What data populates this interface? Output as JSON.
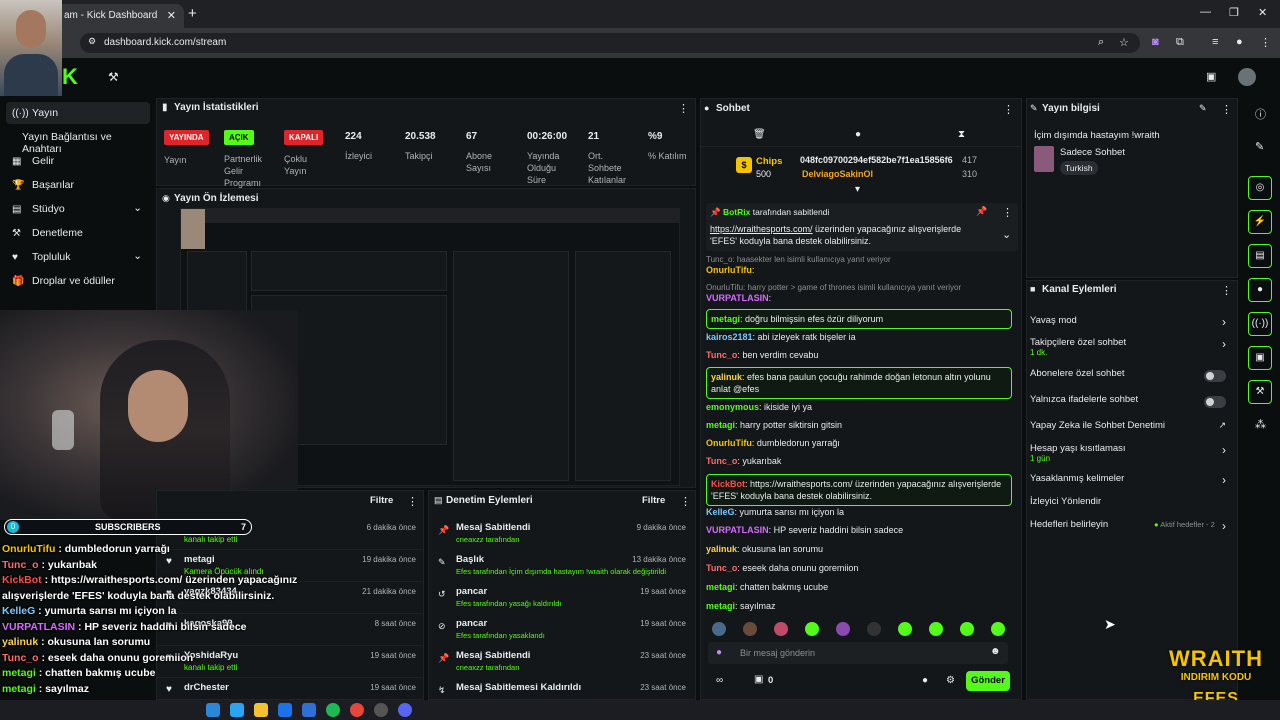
{
  "browser": {
    "tab_title": "am - Kick Dashboard",
    "url": "dashboard.kick.com/stream"
  },
  "sidebar": {
    "items": [
      {
        "label": "Yayın",
        "icon": "broadcast-icon"
      },
      {
        "label": "Yayın Bağlantısı ve Anahtarı",
        "icon": "key-icon"
      },
      {
        "label": "Gelir",
        "icon": "dollar-icon"
      },
      {
        "label": "Başarılar",
        "icon": "trophy-icon"
      },
      {
        "label": "Stüdyo",
        "icon": "studio-icon"
      },
      {
        "label": "Denetleme",
        "icon": "hammer-icon"
      },
      {
        "label": "Topluluk",
        "icon": "community-icon"
      },
      {
        "label": "Droplar ve ödüller",
        "icon": "gift-icon"
      }
    ]
  },
  "stats": {
    "title": "Yayın İstatistikleri",
    "badges": [
      {
        "badge": "YAYINDA",
        "label": "Yayın",
        "color": "#e0252a"
      },
      {
        "badge": "AÇIK",
        "label": "Partnerlik Gelir Programı",
        "color": "#53fc18"
      },
      {
        "badge": "KAPALI",
        "label": "Çoklu Yayın",
        "color": "#e0252a"
      }
    ],
    "numbers": [
      {
        "value": "224",
        "label": "İzleyici"
      },
      {
        "value": "20.538",
        "label": "Takipçi"
      },
      {
        "value": "67",
        "label": "Abone Sayısı"
      },
      {
        "value": "00:26:00",
        "label": "Yayında Olduğu Süre"
      },
      {
        "value": "21",
        "label": "Ort. Sohbete Katılanlar"
      },
      {
        "value": "%9",
        "label": "% Katılım"
      }
    ]
  },
  "preview": {
    "title": "Yayın Ön İzlemesi"
  },
  "events": {
    "filter_label": "Filtre",
    "rows": [
      {
        "name": "karthon",
        "sub": "kanalı takip etti",
        "time": "6 dakika önce"
      },
      {
        "name": "metagi",
        "sub": "Kamera Öpücük alındı",
        "time": "19 dakika önce"
      },
      {
        "name": "yagzk83434",
        "sub": "",
        "time": "21 dakika önce"
      },
      {
        "name": "kagoska99",
        "sub": "",
        "time": "8 saat önce"
      },
      {
        "name": "YoshidaRyu",
        "sub": "kanalı takip etti",
        "time": "19 saat önce"
      },
      {
        "name": "drChester",
        "sub": "",
        "time": "19 saat önce"
      }
    ]
  },
  "mod_actions": {
    "title": "Denetim Eylemleri",
    "filter_label": "Filtre",
    "rows": [
      {
        "title": "Mesaj Sabitlendi",
        "sub": "cneaxzz tarafından",
        "time": "9 dakika önce"
      },
      {
        "title": "Başlık",
        "sub": "Efes tarafından İçim dışımda hastayım !wraith olarak değiştirildi",
        "time": "13 dakika önce"
      },
      {
        "title": "pancar",
        "sub": "Efes tarafından yasağı kaldırıldı",
        "time": "19 saat önce"
      },
      {
        "title": "pancar",
        "sub": "Efes tarafından yasaklandı",
        "time": "19 saat önce"
      },
      {
        "title": "Mesaj Sabitlendi",
        "sub": "cneaxzz tarafından",
        "time": "23 saat önce"
      },
      {
        "title": "Mesaj Sabitlemesi Kaldırıldı",
        "sub": "",
        "time": "23 saat önce"
      }
    ]
  },
  "overlay": {
    "subscribers_label": "SUBSCRIBERS",
    "sub_count_left": "0",
    "sub_count_right": "7",
    "lines": [
      {
        "user": "OnurluTifu",
        "text": " : dumbledorun yarrağı",
        "color": "#f5c400"
      },
      {
        "user": "Tunc_o",
        "text": " : yukarıbak",
        "color": "#ff6b6b"
      },
      {
        "user": "KickBot",
        "text": " : https://wraithesports.com/ üzerinden yapacağınız",
        "color": "#ff4d4d"
      },
      {
        "user": "",
        "text": "alışverişlerde 'EFES' koduyla bana destek olabilirsiniz.",
        "color": "#fff"
      },
      {
        "user": "KelleG",
        "text": " : yumurta sarısı mı içiyon la",
        "color": "#7ec8ff"
      },
      {
        "user": "VURPATLASIN",
        "text": " : HP severiz haddini bilsin sadece",
        "color": "#d66bff"
      },
      {
        "user": "yalinuk",
        "text": " : okusuna lan sorumu",
        "color": "#ffd34d"
      },
      {
        "user": "Tunc_o",
        "text": " : eseek daha onunu goremiion",
        "color": "#ff6b6b"
      },
      {
        "user": "metagi",
        "text": " : chatten bakmış ucube",
        "color": "#53fc18"
      },
      {
        "user": "metagi",
        "text": " : sayılmaz",
        "color": "#53fc18"
      }
    ]
  },
  "chat": {
    "title": "Sohbet",
    "chips_label": "Chips",
    "chips_value": "500",
    "chip_user1": "048fc09700294ef582be7f1ea15856f6",
    "chip_user1_val": "417",
    "chip_user2": "DelviagoSakinOl",
    "chip_user2_val": "310",
    "pinned_by": "BotRix",
    "pinned_suffix": "tarafından sabitlendi",
    "pinned_link": "https://wraithesports.com/",
    "pinned_text": " üzerinden yapacağınız alışverişlerde 'EFES' koduyla bana destek olabilirsiniz.",
    "messages": [
      {
        "user": "",
        "text": "Tunc_o: haasekter len isimli kullanıcıya yanıt veriyor",
        "color": "#8a9094",
        "hl": false
      },
      {
        "user": "OnurluTifu",
        "text": ":",
        "color": "#f5c400",
        "hl": false
      },
      {
        "user": "",
        "text": "OnurluTifu: harry potter > game of thrones isimli kullanıcıya yanıt veriyor",
        "color": "#8a9094",
        "hl": false
      },
      {
        "user": "VURPATLASIN",
        "text": ":",
        "color": "#d66bff",
        "hl": false
      },
      {
        "user": "metagi",
        "text": ": doğru bilmişsin efes özür diliyorum",
        "color": "#53fc18",
        "hl": true
      },
      {
        "user": "kairos2181",
        "text": ": abi izleyek ratk bişeler ia",
        "color": "#7ec8ff",
        "hl": false
      },
      {
        "user": "Tunc_o",
        "text": ": ben verdim cevabu",
        "color": "#ff6b6b",
        "hl": false
      },
      {
        "user": "yalinuk",
        "text": ": efes bana paulun çocuğu rahimde doğan letonun altın yolunu anlat @efes",
        "color": "#ffd34d",
        "hl": true
      },
      {
        "user": "emonymous",
        "text": ": ikiside iyi ya",
        "color": "#53fc18",
        "hl": false
      },
      {
        "user": "metagi",
        "text": ": harry potter siktirsin gitsin",
        "color": "#53fc18",
        "hl": false
      },
      {
        "user": "OnurluTifu",
        "text": ": dumbledorun yarrağı",
        "color": "#f5c400",
        "hl": false
      },
      {
        "user": "Tunc_o",
        "text": ": yukarıbak",
        "color": "#ff6b6b",
        "hl": false
      },
      {
        "user": "KickBot",
        "text": ": https://wraithesports.com/ üzerinden yapacağınız alışverişlerde 'EFES' koduyla bana destek olabilirsiniz.",
        "color": "#ff4d4d",
        "hl": true
      },
      {
        "user": "KelleG",
        "text": ": yumurta sarısı mı içiyon la",
        "color": "#7ec8ff",
        "hl": false
      },
      {
        "user": "VURPATLASIN",
        "text": ": HP severiz haddini bilsin sadece",
        "color": "#d66bff",
        "hl": false
      },
      {
        "user": "yalinuk",
        "text": ": okusuna lan sorumu",
        "color": "#ffd34d",
        "hl": false
      },
      {
        "user": "Tunc_o",
        "text": ": eseek daha onunu goremiion",
        "color": "#ff6b6b",
        "hl": false
      },
      {
        "user": "metagi",
        "text": ": chatten bakmış ucube",
        "color": "#53fc18",
        "hl": false
      },
      {
        "user": "metagi",
        "text": ": sayılmaz",
        "color": "#53fc18",
        "hl": false
      }
    ],
    "input_placeholder": "Bir mesaj gönderin",
    "points": "0",
    "send_label": "Gönder"
  },
  "stream_info": {
    "title": "Yayın bilgisi",
    "stream_title": "İçim dışımda hastayım !wraith",
    "category": "Sadece Sohbet",
    "language": "Turkish"
  },
  "channel_actions": {
    "title": "Kanal Eylemleri",
    "options": [
      {
        "label": "Yavaş mod",
        "sub": "",
        "control": "chevron"
      },
      {
        "label": "Takipçilere özel sohbet",
        "sub": "1 dk.",
        "control": "chevron"
      },
      {
        "label": "Abonelere özel sohbet",
        "sub": "",
        "control": "toggle"
      },
      {
        "label": "Yalnızca ifadelerle sohbet",
        "sub": "",
        "control": "toggle"
      },
      {
        "label": "Yapay Zeka ile Sohbet Denetimi",
        "sub": "",
        "control": "external"
      },
      {
        "label": "Hesap yaşı kısıtlaması",
        "sub": "1 gün",
        "control": "chevron"
      },
      {
        "label": "Yasaklanmış kelimeler",
        "sub": "",
        "control": "chevron"
      },
      {
        "label": "İzleyici Yönlendir",
        "sub": "",
        "control": ""
      },
      {
        "label": "Hedefleri belirleyin",
        "sub": "",
        "control": "chevron"
      }
    ],
    "goals_status": "Aktif hedefler - 2"
  },
  "sponsor": {
    "brand": "WRAITH",
    "code": "INDIRIM KODU",
    "code_value": "EFES"
  },
  "colors": {
    "accent": "#53fc18",
    "live": "#e0252a",
    "bg": "#0b0e0f",
    "panel": "#141719"
  }
}
